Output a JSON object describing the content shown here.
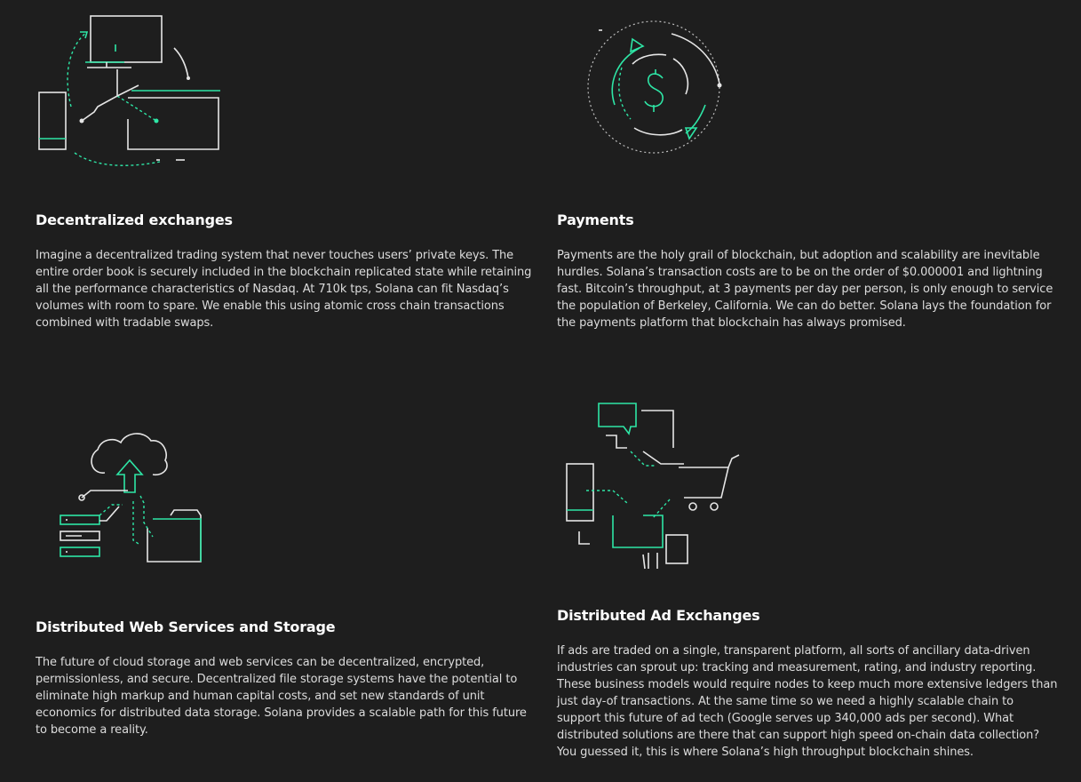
{
  "cards": [
    {
      "title": "Decentralized exchanges",
      "body": "Imagine a decentralized trading system that never touches users’ private keys. The entire order book is securely included in the blockchain replicated state while retaining all the performance characteristics of Nasdaq. At 710k tps, Solana can fit Nasdaq’s volumes with room to spare. We enable this using atomic cross chain transactions combined with tradable swaps.",
      "icon": "exchange-network-icon"
    },
    {
      "title": "Payments",
      "body": "Payments are the holy grail of blockchain, but adoption and scalability are inevitable hurdles. Solana’s transaction costs are to be on the order of $0.000001 and lightning fast. Bitcoin’s throughput, at 3 payments per day per person, is only enough to service the population of Berkeley, California. We can do better. Solana lays the foundation for the payments platform that blockchain has always promised.",
      "icon": "dollar-cycle-icon"
    },
    {
      "title": "Distributed Web Services and Storage",
      "body": "The future of cloud storage and web services can be decentralized, encrypted, permissionless, and secure. Decentralized file storage systems have the potential to eliminate high markup and human capital costs, and set new standards of unit economics for distributed data storage. Solana provides a scalable path for this future to become a reality.",
      "icon": "cloud-storage-icon"
    },
    {
      "title": "Distributed Ad Exchanges",
      "body": "If ads are traded on a single, transparent platform, all sorts of ancillary data-driven industries can sprout up: tracking and measurement, rating, and industry reporting. These business models would require nodes to keep much more extensive ledgers than just day-of transactions. At the same time so we need a highly scalable chain to support this future of ad tech (Google serves up 340,000 ads per second). What distributed solutions are there that can support high speed on-chain data collection? You guessed it, this is where Solana’s high throughput blockchain shines.",
      "icon": "ad-exchange-icon"
    }
  ],
  "colors": {
    "background": "#1e1e1e",
    "accent": "#2ee6a6",
    "line": "#e6e6e6"
  }
}
